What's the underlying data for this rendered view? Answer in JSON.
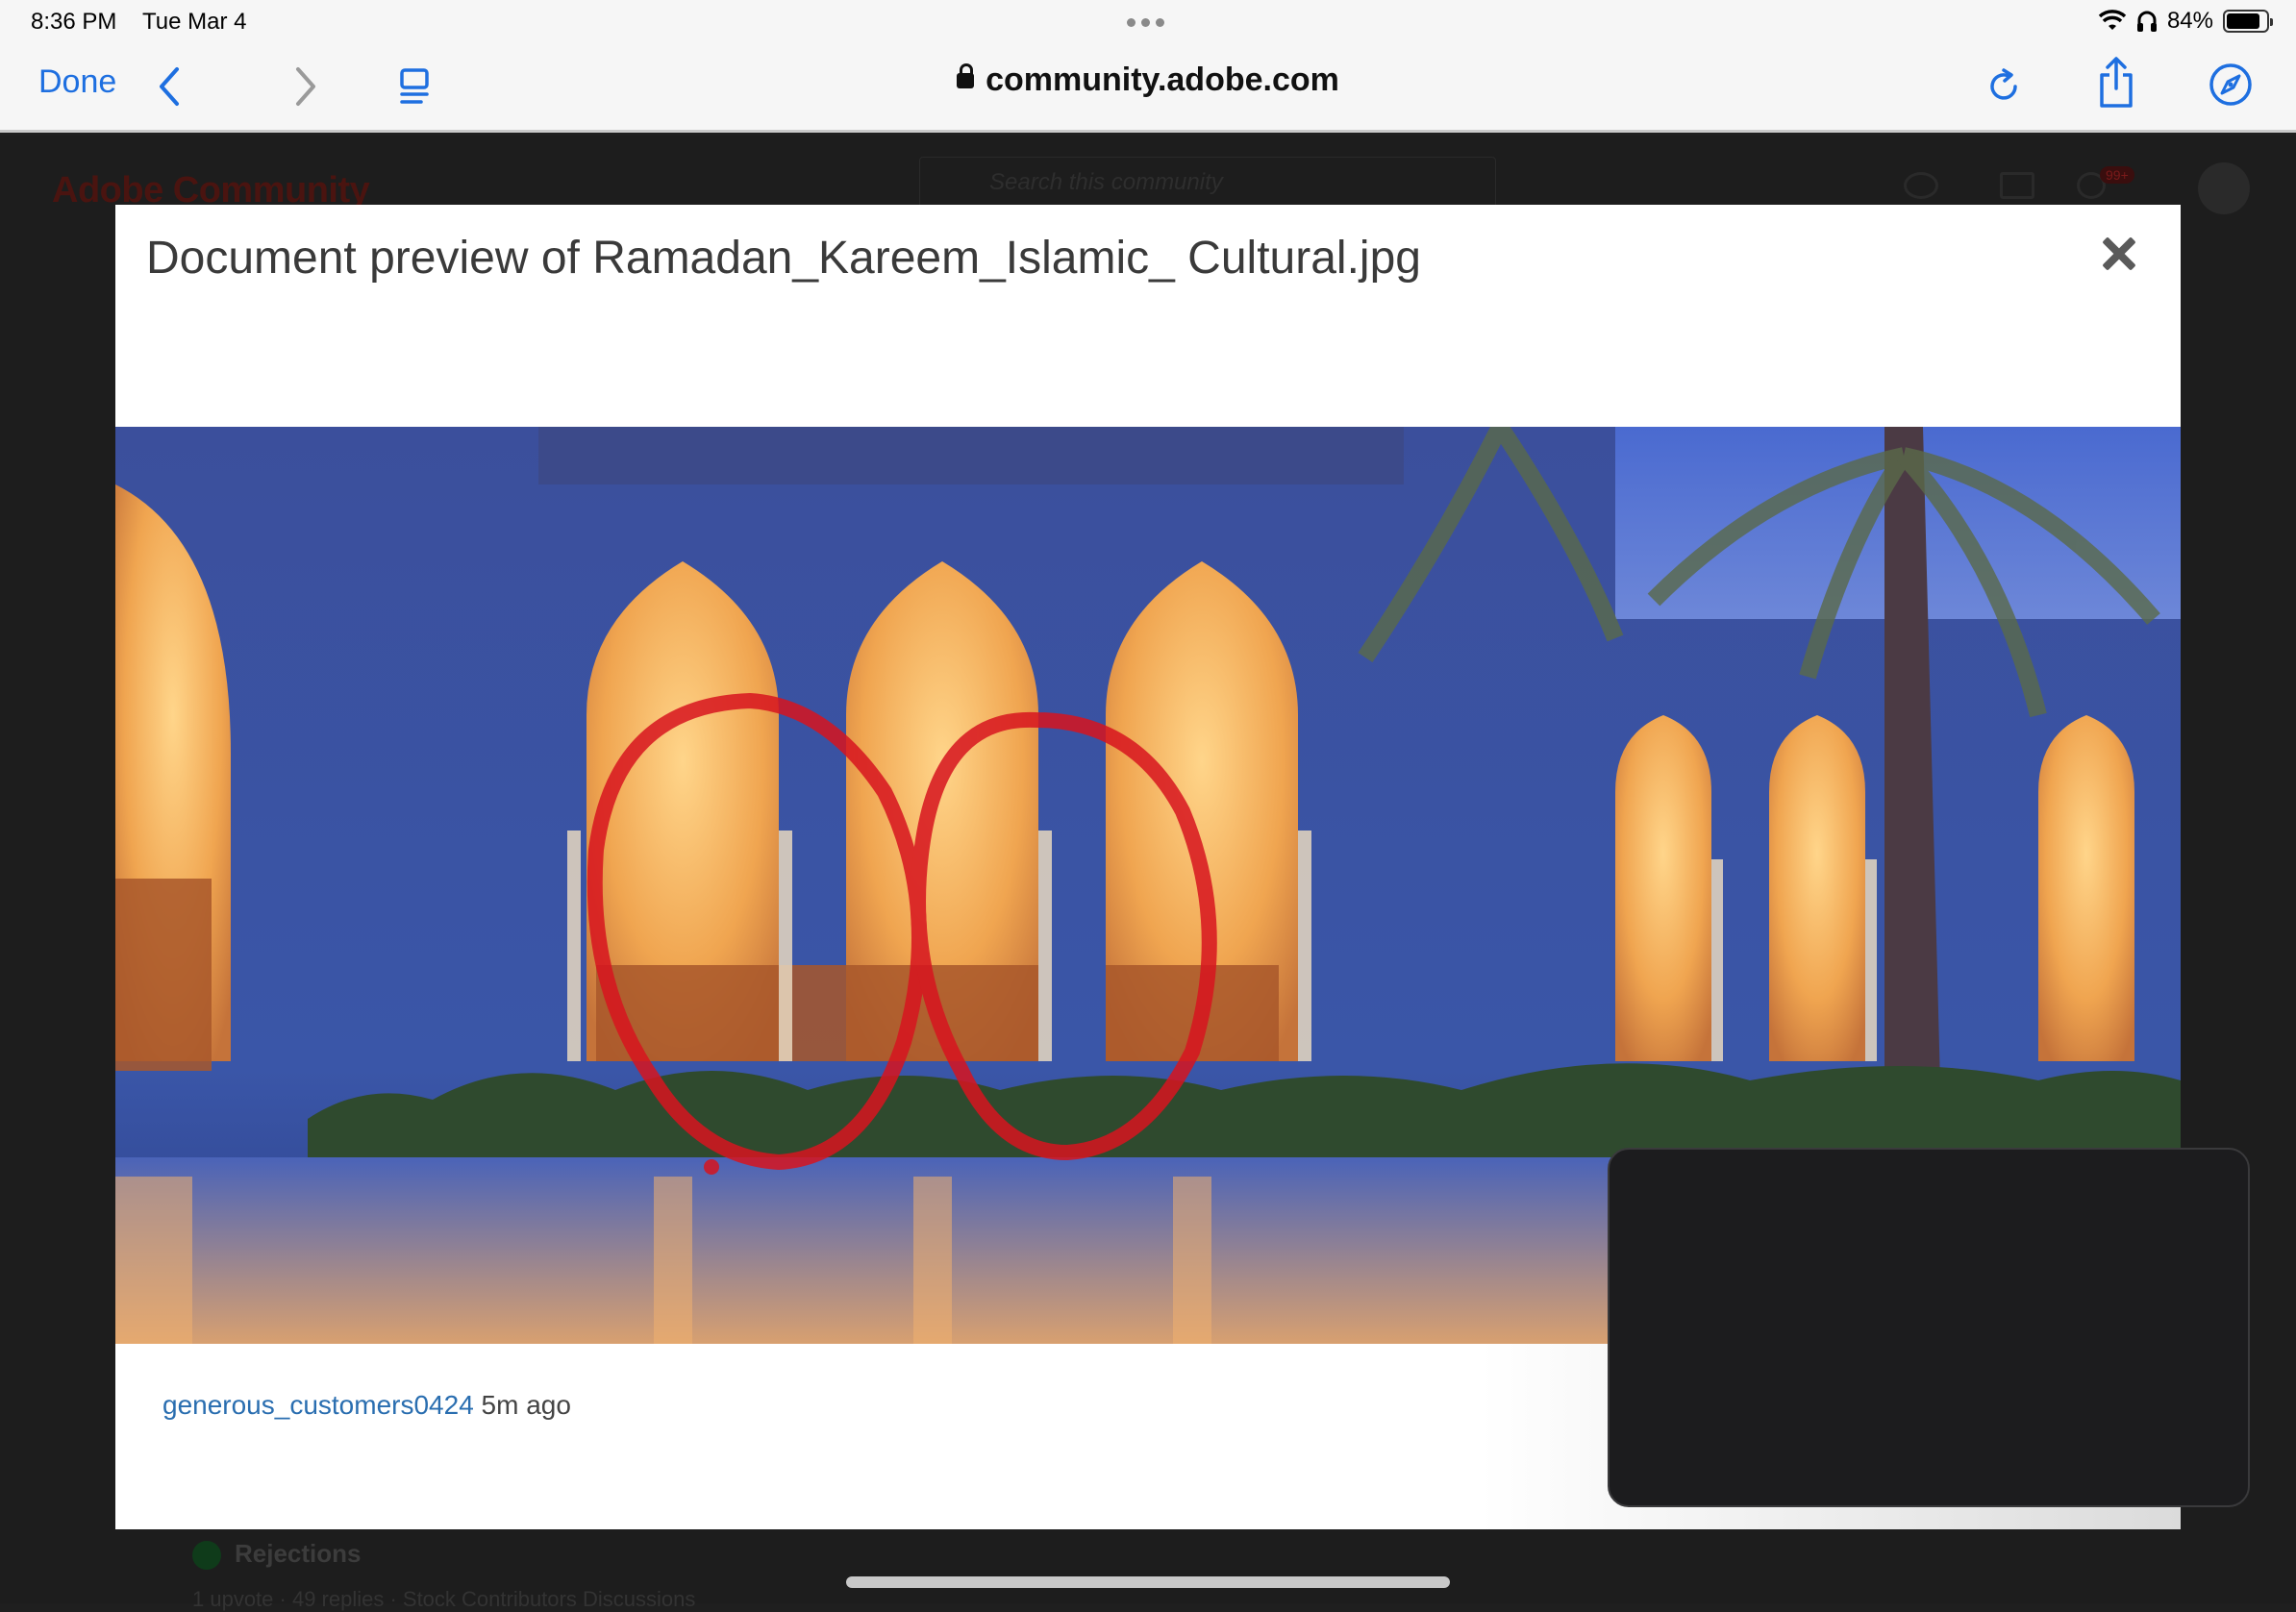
{
  "status_bar": {
    "time": "8:36 PM",
    "date": "Tue Mar 4",
    "battery_percent": "84%",
    "battery_level": 0.84
  },
  "browser": {
    "done_label": "Done",
    "url": "community.adobe.com"
  },
  "background_page": {
    "logo": "Adobe Community",
    "search_placeholder": "Search this community",
    "notification_badge": "99+",
    "bottom_item": "Rejections",
    "bottom_meta": "1 upvote · 49 replies · Stock Contributors Discussions"
  },
  "modal": {
    "title": "Document preview of Ramadan_Kareem_Islamic_ Cultural.jpg",
    "author": "generous_customers0424",
    "time_ago": "5m ago"
  },
  "colors": {
    "accent": "#1e6fe0",
    "link": "#2a6eb0",
    "annotation": "#d7141f"
  }
}
